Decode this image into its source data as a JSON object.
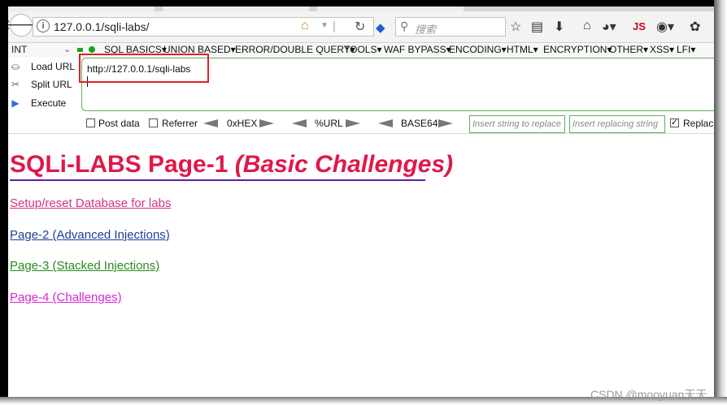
{
  "browser": {
    "url": "127.0.0.1/sqli-labs/",
    "search_placeholder": "搜索",
    "js_label": "JS"
  },
  "hackbar": {
    "select_value": "INT",
    "menus": [
      "SQL BASICS▾",
      "UNION BASED▾",
      "ERROR/DOUBLE QUERY▾",
      "TOOLS▾",
      "WAF BYPASS▾",
      "ENCODING▾",
      "HTML▾",
      "ENCRYPTION▾",
      "OTHER▾",
      "XSS▾",
      "LFI▾"
    ],
    "load_url_label": "Load URL",
    "split_url_label": "Split URL",
    "execute_label": "Execute",
    "url_value": "http://127.0.0.1/sqli-labs",
    "post_data_label": "Post data",
    "referrer_label": "Referrer",
    "hex_label": "0xHEX",
    "url_enc_label": "%URL",
    "base64_label": "BASE64",
    "replace_placeholder": "Insert string to replace",
    "replacing_placeholder": "Insert replacing string",
    "replace_label": "Replac",
    "post_data_checked": false,
    "referrer_checked": false,
    "replace_checked": true
  },
  "page": {
    "title_main": "SQLi-LABS Page-1",
    "title_sub": "(Basic Challenges)",
    "links": [
      {
        "label": "Setup/reset Database for labs",
        "color": "#d63384"
      },
      {
        "label": "Page-2 (Advanced Injections)",
        "color": "#1f3d9c"
      },
      {
        "label": "Page-3 (Stacked Injections)",
        "color": "#2a8a1e"
      },
      {
        "label": "Page-4 (Challenges)",
        "color": "#d627d6"
      }
    ]
  },
  "watermark": "CSDN @mooyuan天天",
  "colors": {
    "title": "#e0184a",
    "highlight_box": "#e0202a",
    "hackbar_border": "#60b060"
  }
}
